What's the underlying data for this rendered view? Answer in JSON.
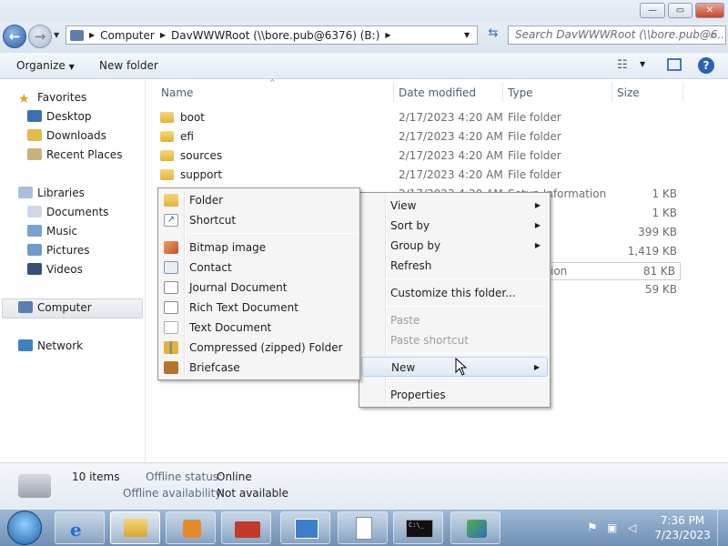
{
  "window": {
    "minimize": "—",
    "maximize": "▭",
    "close": "✕"
  },
  "address": {
    "crumb1": "Computer",
    "crumb2": "DavWWWRoot (\\\\bore.pub@6376) (B:)",
    "search_placeholder": "Search DavWWWRoot (\\\\bore.pub@6..."
  },
  "toolbar": {
    "organize": "Organize",
    "new_folder": "New folder"
  },
  "nav": {
    "favorites": "Favorites",
    "desktop": "Desktop",
    "downloads": "Downloads",
    "recent": "Recent Places",
    "libraries": "Libraries",
    "documents": "Documents",
    "music": "Music",
    "pictures": "Pictures",
    "videos": "Videos",
    "computer": "Computer",
    "network": "Network"
  },
  "columns": {
    "name": "Name",
    "date": "Date modified",
    "type": "Type",
    "size": "Size"
  },
  "files": [
    {
      "name": "boot",
      "date": "2/17/2023 4:20 AM",
      "type": "File folder",
      "size": ""
    },
    {
      "name": "efi",
      "date": "2/17/2023 4:20 AM",
      "type": "File folder",
      "size": ""
    },
    {
      "name": "sources",
      "date": "2/17/2023 4:20 AM",
      "type": "File folder",
      "size": ""
    },
    {
      "name": "support",
      "date": "2/17/2023 4:20 AM",
      "type": "File folder",
      "size": ""
    },
    {
      "name": "",
      "date": "2/17/2023 4:20 AM",
      "type": "Setup Information",
      "size": "1 KB"
    },
    {
      "name": "",
      "date": "",
      "type": "",
      "size": "1 KB"
    },
    {
      "name": "",
      "date": "",
      "type": "",
      "size": "399 KB"
    },
    {
      "name": "",
      "date": "",
      "type": "",
      "size": "1,419 KB"
    },
    {
      "name": "",
      "date": "",
      "type": "ion",
      "size": "81 KB"
    },
    {
      "name": "",
      "date": "",
      "type": "",
      "size": "59 KB"
    }
  ],
  "context_menu": {
    "view": "View",
    "sort_by": "Sort by",
    "group_by": "Group by",
    "refresh": "Refresh",
    "customize": "Customize this folder...",
    "paste": "Paste",
    "paste_shortcut": "Paste shortcut",
    "new": "New",
    "properties": "Properties"
  },
  "new_submenu": {
    "folder": "Folder",
    "shortcut": "Shortcut",
    "bitmap": "Bitmap image",
    "contact": "Contact",
    "journal": "Journal Document",
    "rtf": "Rich Text Document",
    "text": "Text Document",
    "zip": "Compressed (zipped) Folder",
    "briefcase": "Briefcase"
  },
  "status": {
    "items": "10 items",
    "offline_status_label": "Offline status:",
    "offline_status": "Online",
    "offline_avail_label": "Offline availability:",
    "offline_avail": "Not available"
  },
  "clock": {
    "time": "7:36 PM",
    "date": "7/23/2023"
  }
}
